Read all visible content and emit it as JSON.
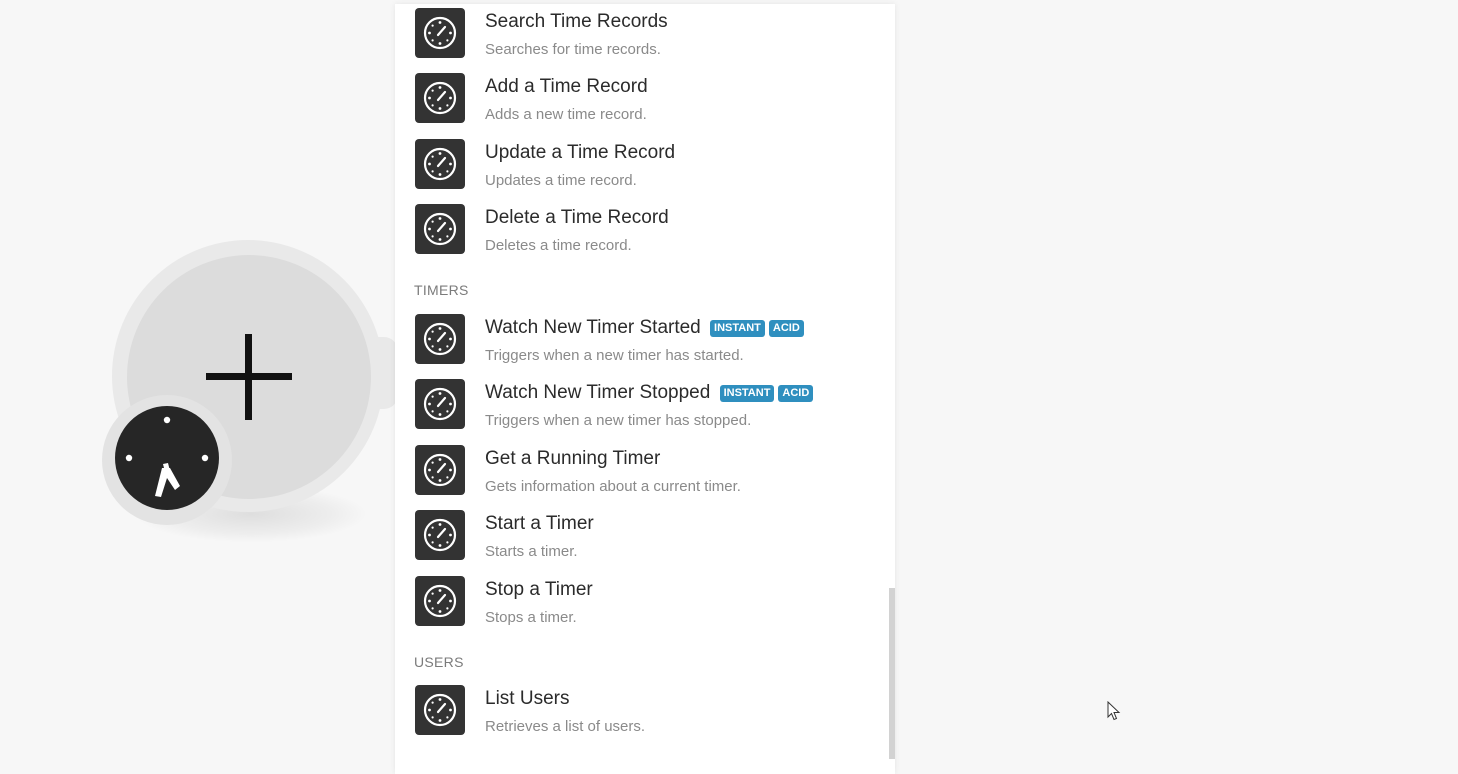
{
  "sections": {
    "timers": "TIMERS",
    "users": "USERS"
  },
  "items": [
    {
      "title": "Search Time Records",
      "desc": "Searches for time records.",
      "badges": []
    },
    {
      "title": "Add a Time Record",
      "desc": "Adds a new time record.",
      "badges": []
    },
    {
      "title": "Update a Time Record",
      "desc": "Updates a time record.",
      "badges": []
    },
    {
      "title": "Delete a Time Record",
      "desc": "Deletes a time record.",
      "badges": []
    },
    {
      "title": "Watch New Timer Started",
      "desc": "Triggers when a new timer has started.",
      "badges": [
        "INSTANT",
        "ACID"
      ]
    },
    {
      "title": "Watch New Timer Stopped",
      "desc": "Triggers when a new timer has stopped.",
      "badges": [
        "INSTANT",
        "ACID"
      ]
    },
    {
      "title": "Get a Running Timer",
      "desc": "Gets information about a current timer.",
      "badges": []
    },
    {
      "title": "Start a Timer",
      "desc": "Starts a timer.",
      "badges": []
    },
    {
      "title": "Stop a Timer",
      "desc": "Stops a timer.",
      "badges": []
    },
    {
      "title": "List Users",
      "desc": "Retrieves a list of users.",
      "badges": []
    }
  ],
  "colors": {
    "badge": "#2f8fbf",
    "icon_bg": "#333333",
    "canvas_bg": "#f7f7f7"
  },
  "icons": {
    "module_icon": "clock-icon",
    "add_icon": "plus-icon"
  }
}
